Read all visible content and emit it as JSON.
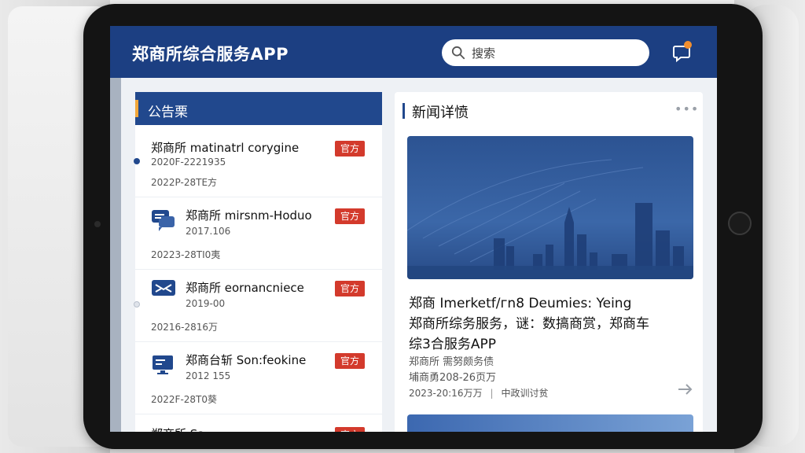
{
  "header": {
    "app_title": "郑商所综合服务APP",
    "search_placeholder": "搜索",
    "bell_icon": "message-bell-icon",
    "badge_dot_color": "#f28f2f"
  },
  "notice_panel": {
    "title": "公告栗",
    "items": [
      {
        "title": "郑商所 matinatrl corygine",
        "sub": "2020F-2221935",
        "date": "2022P-28TE方",
        "badge": "官方",
        "icon": "dot"
      },
      {
        "title": "郑商所 mirsnm-Hoduo",
        "sub": "2017.106",
        "date": "20223-28TI0夷",
        "badge": "官方",
        "icon": "chat-icon"
      },
      {
        "title": "郑商所 eornancniece",
        "sub": "2019-00",
        "date": "20216-2816万",
        "badge": "官方",
        "icon": "mail-icon"
      },
      {
        "title": "郑商台斩 Son:feokine",
        "sub": "2012 155",
        "date": "2022F-28T0葵",
        "badge": "官方",
        "icon": "monitor-icon"
      },
      {
        "title": "郑商所 Sa...",
        "sub": "",
        "date": "",
        "badge": "官方",
        "icon": "dot"
      }
    ]
  },
  "news_panel": {
    "title": "新闻详愤",
    "more": "•••",
    "headline_1": "郑商 Imerketf/гn8 Deumies: Yeing",
    "headline_2": "郑商所综务服务，谜：数搞商赏，郑商车",
    "headline_3": "综3合服务APP",
    "meta_1": "郑商所 需努颇务债",
    "meta_2": "埔商勇208-26页万",
    "date": "2023-20:16万万",
    "source": "中政训讨贫"
  },
  "colors": {
    "header_bg": "#1c3f82",
    "badge": "#d33a2c",
    "accent": "#f2a73a"
  }
}
